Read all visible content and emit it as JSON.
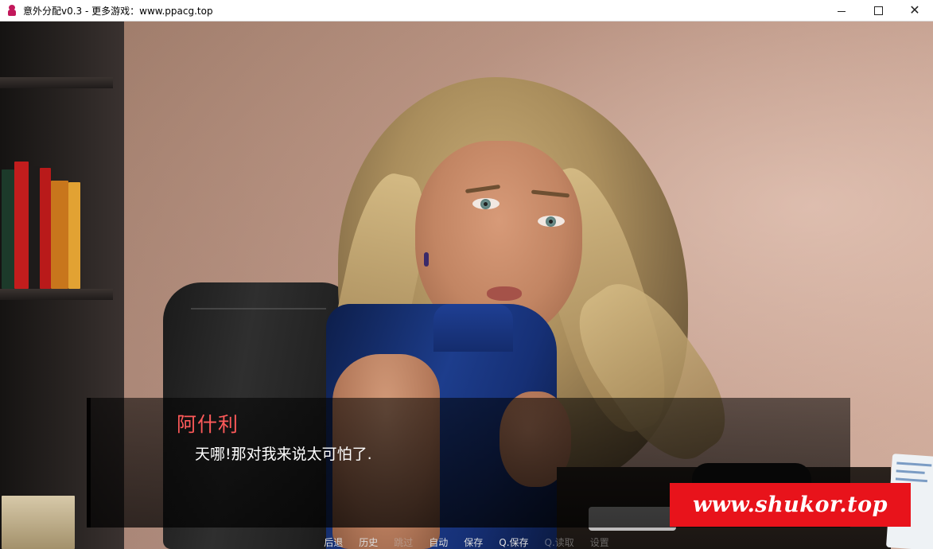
{
  "window": {
    "title": "意外分配v0.3 - 更多游戏：www.ppacg.top",
    "icon": "app-girl-icon",
    "controls": {
      "minimize": "minimize-icon",
      "maximize": "maximize-icon",
      "close": "close-icon"
    }
  },
  "dialogue": {
    "speaker": "阿什利",
    "text": "天哪!那对我来说太可怕了.",
    "speaker_color": "#ff5a5a"
  },
  "quick_menu": {
    "items": [
      "后退",
      "历史",
      "跳过",
      "自动",
      "保存",
      "Q.保存",
      "Q.读取",
      "设置"
    ]
  },
  "watermark": {
    "text": "www.shukor.top",
    "color": "#e8131b"
  }
}
